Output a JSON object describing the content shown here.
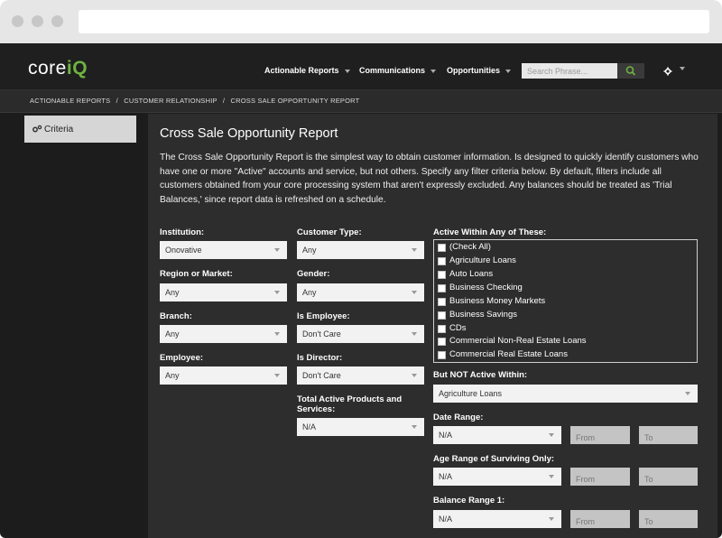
{
  "app": {
    "logo_core": "core",
    "logo_accent": "iQ"
  },
  "nav": {
    "items": [
      {
        "label": "Actionable Reports"
      },
      {
        "label": "Communications"
      },
      {
        "label": "Opportunities"
      }
    ],
    "search_placeholder": "Search Phrase...",
    "search_icon": "search-icon",
    "settings_icon": "gear-icon"
  },
  "breadcrumb": {
    "items": [
      "ACTIONABLE REPORTS",
      "CUSTOMER RELATIONSHIP",
      "CROSS SALE OPPORTUNITY REPORT"
    ],
    "separator": "/"
  },
  "sidebar": {
    "tab_label": "Criteria",
    "tab_icon": "gears-icon"
  },
  "page": {
    "title": "Cross Sale Opportunity Report",
    "description": "The Cross Sale Opportunity Report is the simplest way to obtain customer information. Is designed to quickly identify customers who have one or more \"Active\" accounts and service, but not others. Specify any filter criteria below. By default, filters include all customers obtained from your core processing system that aren't expressly excluded. Any balances should be treated as 'Trial Balances,' since report data is refreshed on a schedule."
  },
  "filters": {
    "institution": {
      "label": "Institution:",
      "value": "Onovative"
    },
    "region": {
      "label": "Region or Market:",
      "value": "Any"
    },
    "branch": {
      "label": "Branch:",
      "value": "Any"
    },
    "employee": {
      "label": "Employee:",
      "value": "Any"
    },
    "customer_type": {
      "label": "Customer Type:",
      "value": "Any"
    },
    "gender": {
      "label": "Gender:",
      "value": "Any"
    },
    "is_employee": {
      "label": "Is Employee:",
      "value": "Don't Care"
    },
    "is_director": {
      "label": "Is Director:",
      "value": "Don't Care"
    },
    "total_active": {
      "label": "Total Active Products and Services:",
      "value": "N/A"
    },
    "active_within": {
      "label": "Active Within Any of These:",
      "options": [
        "(Check All)",
        "Agriculture Loans",
        "Auto Loans",
        "Business Checking",
        "Business Money Markets",
        "Business Savings",
        "CDs",
        "Commercial Non-Real Estate Loans",
        "Commercial Real Estate Loans"
      ]
    },
    "not_active_within": {
      "label": "But NOT Active Within:",
      "value": "Agriculture Loans"
    },
    "date_range": {
      "label": "Date Range:",
      "value": "N/A",
      "from_placeholder": "From",
      "to_placeholder": "To"
    },
    "age_range": {
      "label": "Age Range of Surviving Only:",
      "value": "N/A",
      "from_placeholder": "From",
      "to_placeholder": "To"
    },
    "balance_range_1": {
      "label": "Balance Range 1:",
      "value": "N/A",
      "from_placeholder": "From",
      "to_placeholder": "To"
    }
  },
  "colors": {
    "accent": "#6db33f",
    "background": "#1c1c1c",
    "panel": "#2d2d2d"
  }
}
